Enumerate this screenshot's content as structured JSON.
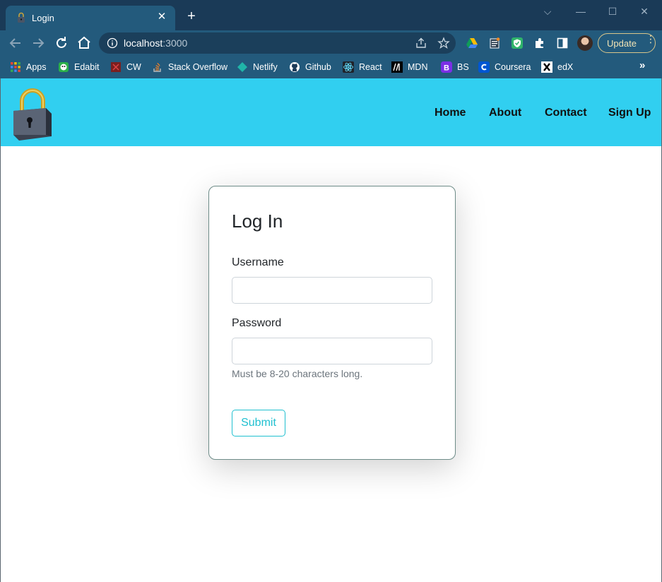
{
  "browser": {
    "tab": {
      "title": "Login",
      "close_glyph": "✕"
    },
    "new_tab_glyph": "+",
    "window_controls": {
      "dropdown": "⌵",
      "minimize": "—",
      "maximize": "☐",
      "close": "✕"
    },
    "address_bar": {
      "host": "localhost",
      "port": ":3000"
    },
    "update_button": {
      "label": "Update",
      "menu_glyph": "⋮"
    },
    "bookmarks": [
      {
        "label": "Apps",
        "icon": "apps-grid-icon"
      },
      {
        "label": "Edabit",
        "icon": "edabit-icon"
      },
      {
        "label": "CW",
        "icon": "codewars-icon"
      },
      {
        "label": "Stack Overflow",
        "icon": "stackoverflow-icon"
      },
      {
        "label": "Netlify",
        "icon": "netlify-icon"
      },
      {
        "label": "Github",
        "icon": "github-icon"
      },
      {
        "label": "React",
        "icon": "react-icon"
      },
      {
        "label": "MDN",
        "icon": "mdn-icon"
      },
      {
        "label": "BS",
        "icon": "bootstrap-icon"
      },
      {
        "label": "Coursera",
        "icon": "coursera-icon"
      },
      {
        "label": "edX",
        "icon": "edx-icon"
      }
    ],
    "bookmarks_more_glyph": "»"
  },
  "site": {
    "logo_icon": "padlock-icon",
    "nav": {
      "home": "Home",
      "about": "About",
      "contact": "Contact",
      "signup": "Sign Up"
    }
  },
  "login": {
    "title": "Log In",
    "username_label": "Username",
    "username_value": "",
    "password_label": "Password",
    "password_value": "",
    "password_help": "Must be 8-20 characters long.",
    "submit_label": "Submit"
  },
  "colors": {
    "browser_frame": "#1a3a57",
    "toolbar": "#235a7c",
    "nav_background": "#31cff0",
    "submit_accent": "#20c0d0"
  }
}
